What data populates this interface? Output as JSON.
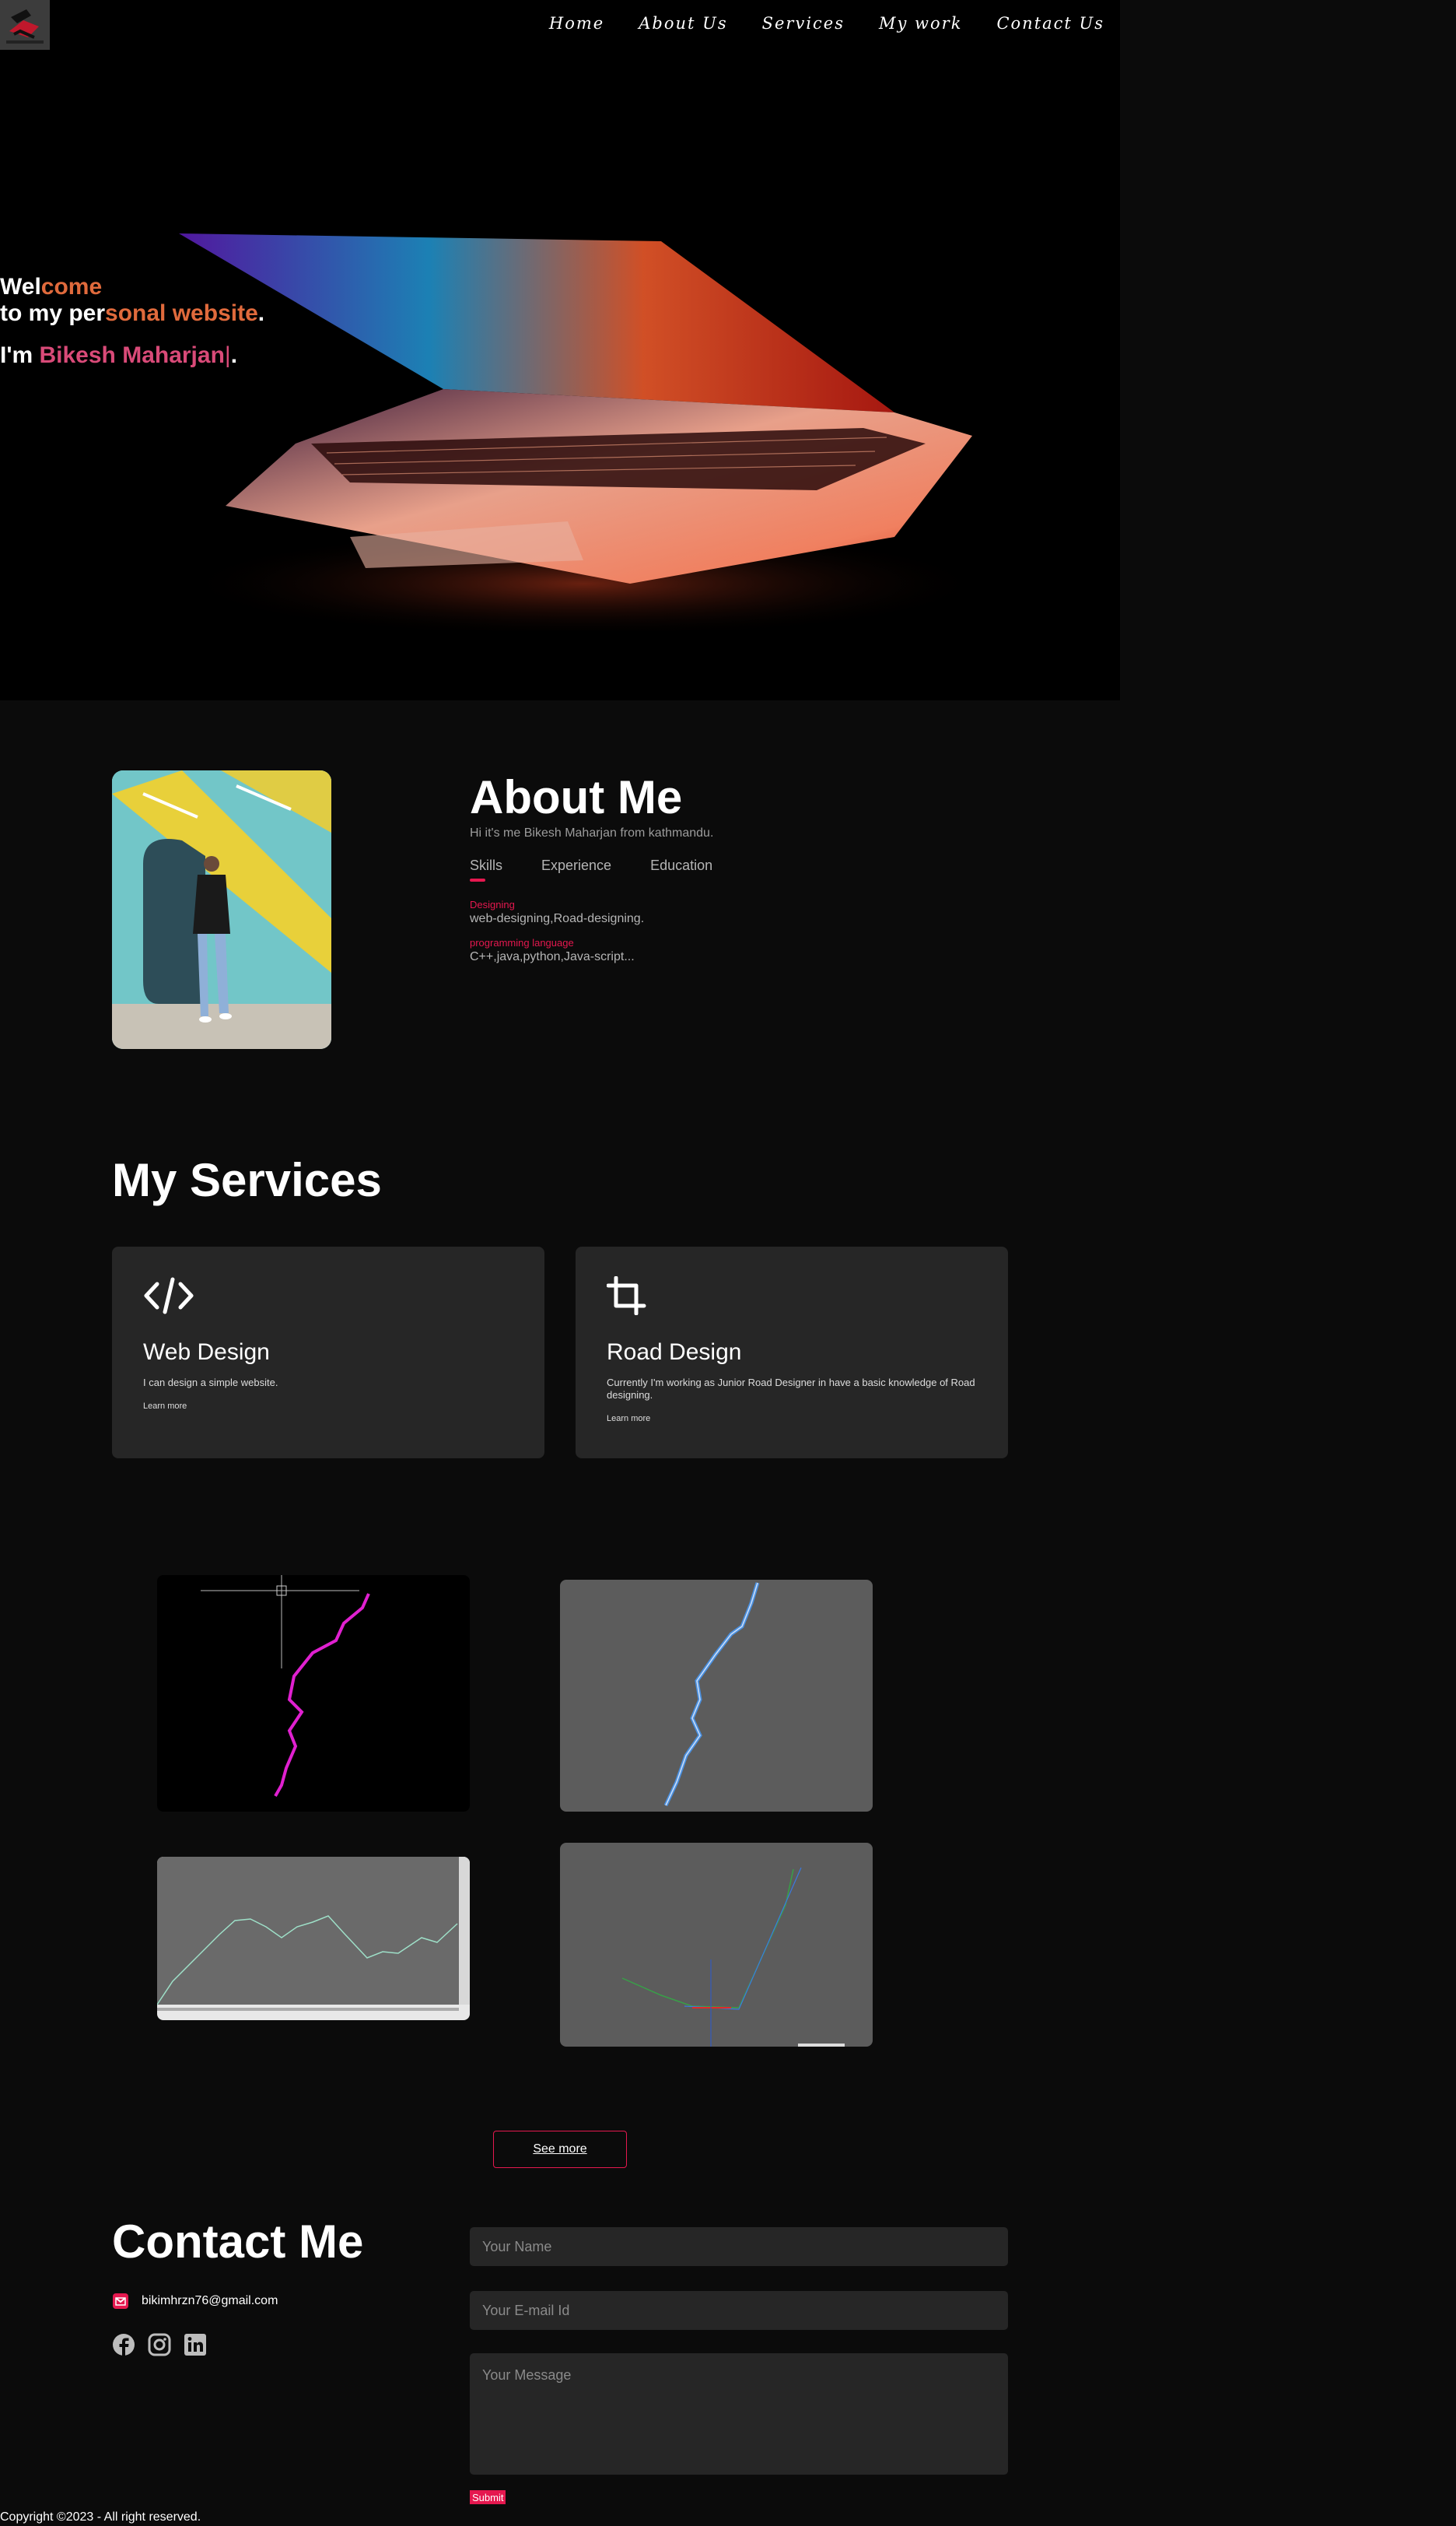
{
  "nav": [
    "Home",
    "About Us",
    "Services",
    "My work",
    "Contact Us"
  ],
  "hero": {
    "l1a": "Wel",
    "l1b": "come",
    "l2a": "to my per",
    "l2b": "sonal website",
    "l2c": ".",
    "l3a": "I'm ",
    "l3b": "Bikesh Maharjan",
    "l3c": "|",
    "l3d": "."
  },
  "about": {
    "title": "About Me",
    "intro": "Hi it's me Bikesh Maharjan from kathmandu.",
    "tabs": [
      "Skills",
      "Experience",
      "Education"
    ],
    "skills": [
      {
        "title": "Designing",
        "value": "web-designing,Road-designing."
      },
      {
        "title": "programming language",
        "value": "C++,java,python,Java-script..."
      }
    ]
  },
  "services": {
    "title": "My Services",
    "cards": [
      {
        "title": "Web Design",
        "desc": "I can design a simple website.",
        "link": "Learn more",
        "icon": "code-icon"
      },
      {
        "title": "Road Design",
        "desc": "Currently I'm working as Junior Road Designer in have a basic knowledge of Road designing.",
        "link": "Learn more",
        "icon": "crop-icon"
      }
    ]
  },
  "work": {
    "see_more": "See more"
  },
  "contact": {
    "title": "Contact Me",
    "email": "bikimhrzn76@gmail.com",
    "name_ph": "Your Name",
    "email_ph": "Your E-mail Id",
    "msg_ph": "Your Message",
    "submit": "Submit"
  },
  "footer": "Copyright ©2023 - All right reserved.",
  "colors": {
    "accent": "#e5184f",
    "orange": "#e06a3c",
    "pink": "#d94a78",
    "card": "#262626"
  }
}
